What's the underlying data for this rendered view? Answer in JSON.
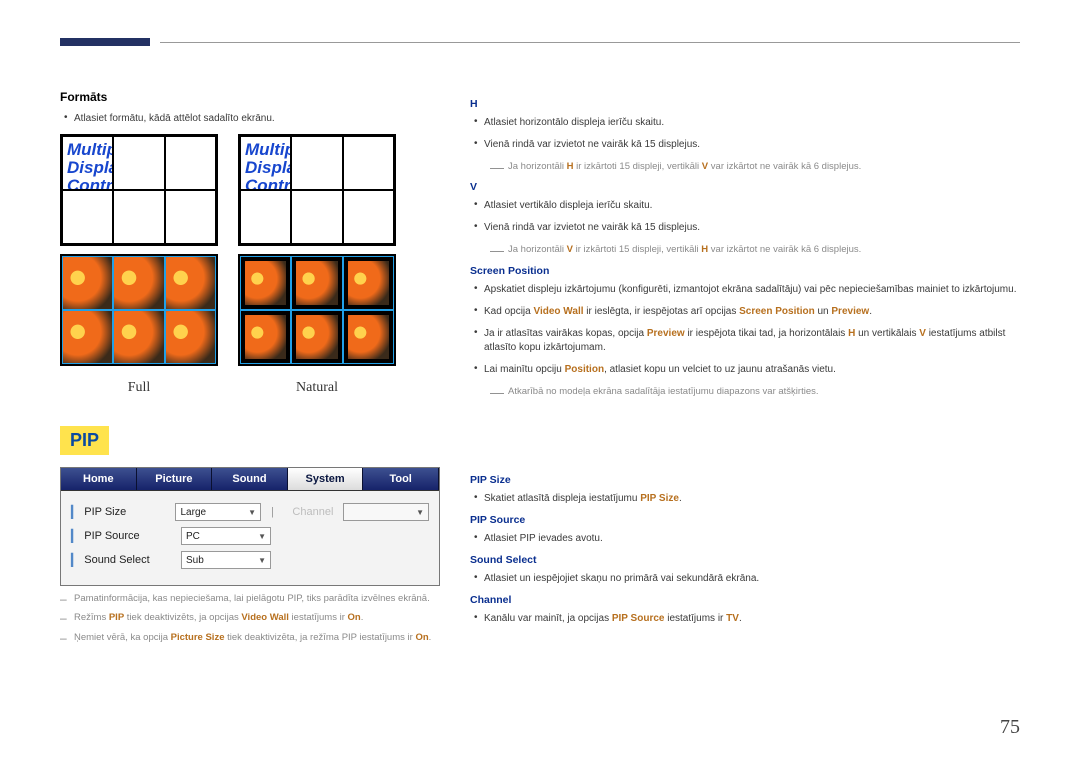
{
  "page_number": "75",
  "left": {
    "formats_heading": "Formāts",
    "formats_bullet": "Atlasiet formātu, kādā attēlot sadalīto ekrānu.",
    "grid_text_line1": "Multiple",
    "grid_text_line2": "Display",
    "grid_text_line3": "Control",
    "caption_full": "Full",
    "caption_natural": "Natural",
    "pip_badge": "PIP",
    "pip_tabs": [
      "Home",
      "Picture",
      "Sound",
      "System",
      "Tool"
    ],
    "pip_active_tab_index": 3,
    "pip_rows": [
      {
        "label": "PIP Size",
        "value": "Large",
        "secondary_label": "Channel",
        "secondary_disabled": true
      },
      {
        "label": "PIP Source",
        "value": "PC"
      },
      {
        "label": "Sound Select",
        "value": "Sub"
      }
    ],
    "note_basic": "Pamatinformācija, kas nepieciešama, lai pielāgotu PIP, tiks parādīta izvēlnes ekrānā.",
    "note_deact_pip_pre": "Režīms ",
    "note_deact_pip_bold1": "PIP",
    "note_deact_pip_mid": " tiek deaktivizēts, ja opcijas ",
    "note_deact_pip_bold2": "Video Wall",
    "note_deact_pip_post": " iestatījums ir ",
    "note_deact_pip_bold3": "On",
    "note_deact_pip_end": ".",
    "note_picsize_pre": "Ņemiet vērā, ka opcija ",
    "note_picsize_bold": "Picture Size",
    "note_picsize_mid": " tiek deaktivizēta, ja režīma PIP iestatījums ir ",
    "note_picsize_bold2": "On",
    "note_picsize_end": "."
  },
  "right": {
    "h_heading": "H",
    "h_b1": "Atlasiet horizontālo displeja ierīču skaitu.",
    "h_b2": "Vienā rindā var izvietot ne vairāk kā 15 displejus.",
    "h_note_pre": "Ja horizontāli ",
    "h_note_b1": "H",
    "h_note_mid1": " ir izkārtoti 15 displeji, vertikāli ",
    "h_note_b2": "V",
    "h_note_post": " var izkārtot ne vairāk kā 6 displejus.",
    "v_heading": "V",
    "v_b1": "Atlasiet vertikālo displeja ierīču skaitu.",
    "v_b2": "Vienā rindā var izvietot ne vairāk kā 15 displejus.",
    "v_note_pre": "Ja horizontāli ",
    "v_note_b1": "V",
    "v_note_mid1": " ir izkārtoti 15 displeji, vertikāli ",
    "v_note_b2": "H",
    "v_note_post": " var izkārtot ne vairāk kā 6 displejus.",
    "sp_heading": "Screen Position",
    "sp_b1": "Apskatiet displeju izkārtojumu (konfigurēti, izmantojot ekrāna sadalītāju) vai pēc nepieciešamības mainiet to izkārtojumu.",
    "sp_b2_pre": "Kad opcija ",
    "sp_b2_bold1": "Video Wall",
    "sp_b2_mid": " ir ieslēgta, ir iespējotas arī opcijas ",
    "sp_b2_bold2": "Screen Position",
    "sp_b2_and": " un ",
    "sp_b2_bold3": "Preview",
    "sp_b2_end": ".",
    "sp_b3_pre": "Ja ir atlasītas vairākas kopas, opcija ",
    "sp_b3_bold1": "Preview",
    "sp_b3_mid1": " ir iespējota tikai tad, ja horizontālais ",
    "sp_b3_bold2": "H",
    "sp_b3_mid2": " un vertikālais ",
    "sp_b3_bold3": "V",
    "sp_b3_post": " iestatījums atbilst atlasīto kopu izkārtojumam.",
    "sp_b4_pre": "Lai mainītu opciju ",
    "sp_b4_bold": "Position",
    "sp_b4_post": ", atlasiet kopu un velciet to uz jaunu atrašanās vietu.",
    "sp_note": "Atkarībā no modeļa ekrāna sadalītāja iestatījumu diapazons var atšķirties.",
    "ps_heading": "PIP Size",
    "ps_b1_pre": "Skatiet atlasītā displeja iestatījumu ",
    "ps_b1_bold": "PIP Size",
    "ps_b1_end": ".",
    "psource_heading": "PIP Source",
    "psource_b1": "Atlasiet PIP ievades avotu.",
    "ss_heading": "Sound Select",
    "ss_b1": "Atlasiet un iespējojiet skaņu no primārā vai sekundārā ekrāna.",
    "ch_heading": "Channel",
    "ch_b1_pre": "Kanālu var mainīt, ja opcijas ",
    "ch_b1_bold": "PIP Source",
    "ch_b1_mid": " iestatījums ir ",
    "ch_b1_bold2": "TV",
    "ch_b1_end": "."
  }
}
